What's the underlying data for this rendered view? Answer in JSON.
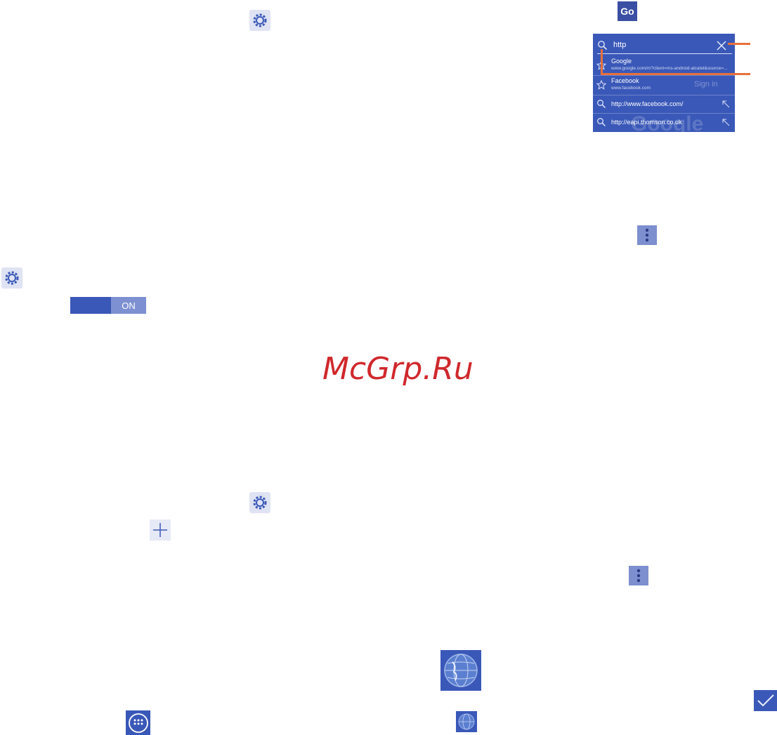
{
  "go_button": {
    "label": "Go"
  },
  "browser_suggestions": {
    "query": "http",
    "items": [
      {
        "icon": "star-icon",
        "title": "Google",
        "url": "www.google.com/m?client=ms-android-alcatel&source=..."
      },
      {
        "icon": "star-icon",
        "title": "Facebook",
        "url": "www.facebook.com"
      },
      {
        "icon": "search-icon",
        "title": "http://www.facebook.com/"
      },
      {
        "icon": "search-icon",
        "title": "http://eapi.thomson.co.uk"
      }
    ],
    "background_text": {
      "signin": "Sign in",
      "brand": "Google"
    }
  },
  "toggle": {
    "label": "ON"
  },
  "watermark": {
    "text": "McGrp.Ru"
  },
  "colors": {
    "accent": "#3a58b8",
    "callout": "#e8703a",
    "watermark": "#d0282c"
  }
}
